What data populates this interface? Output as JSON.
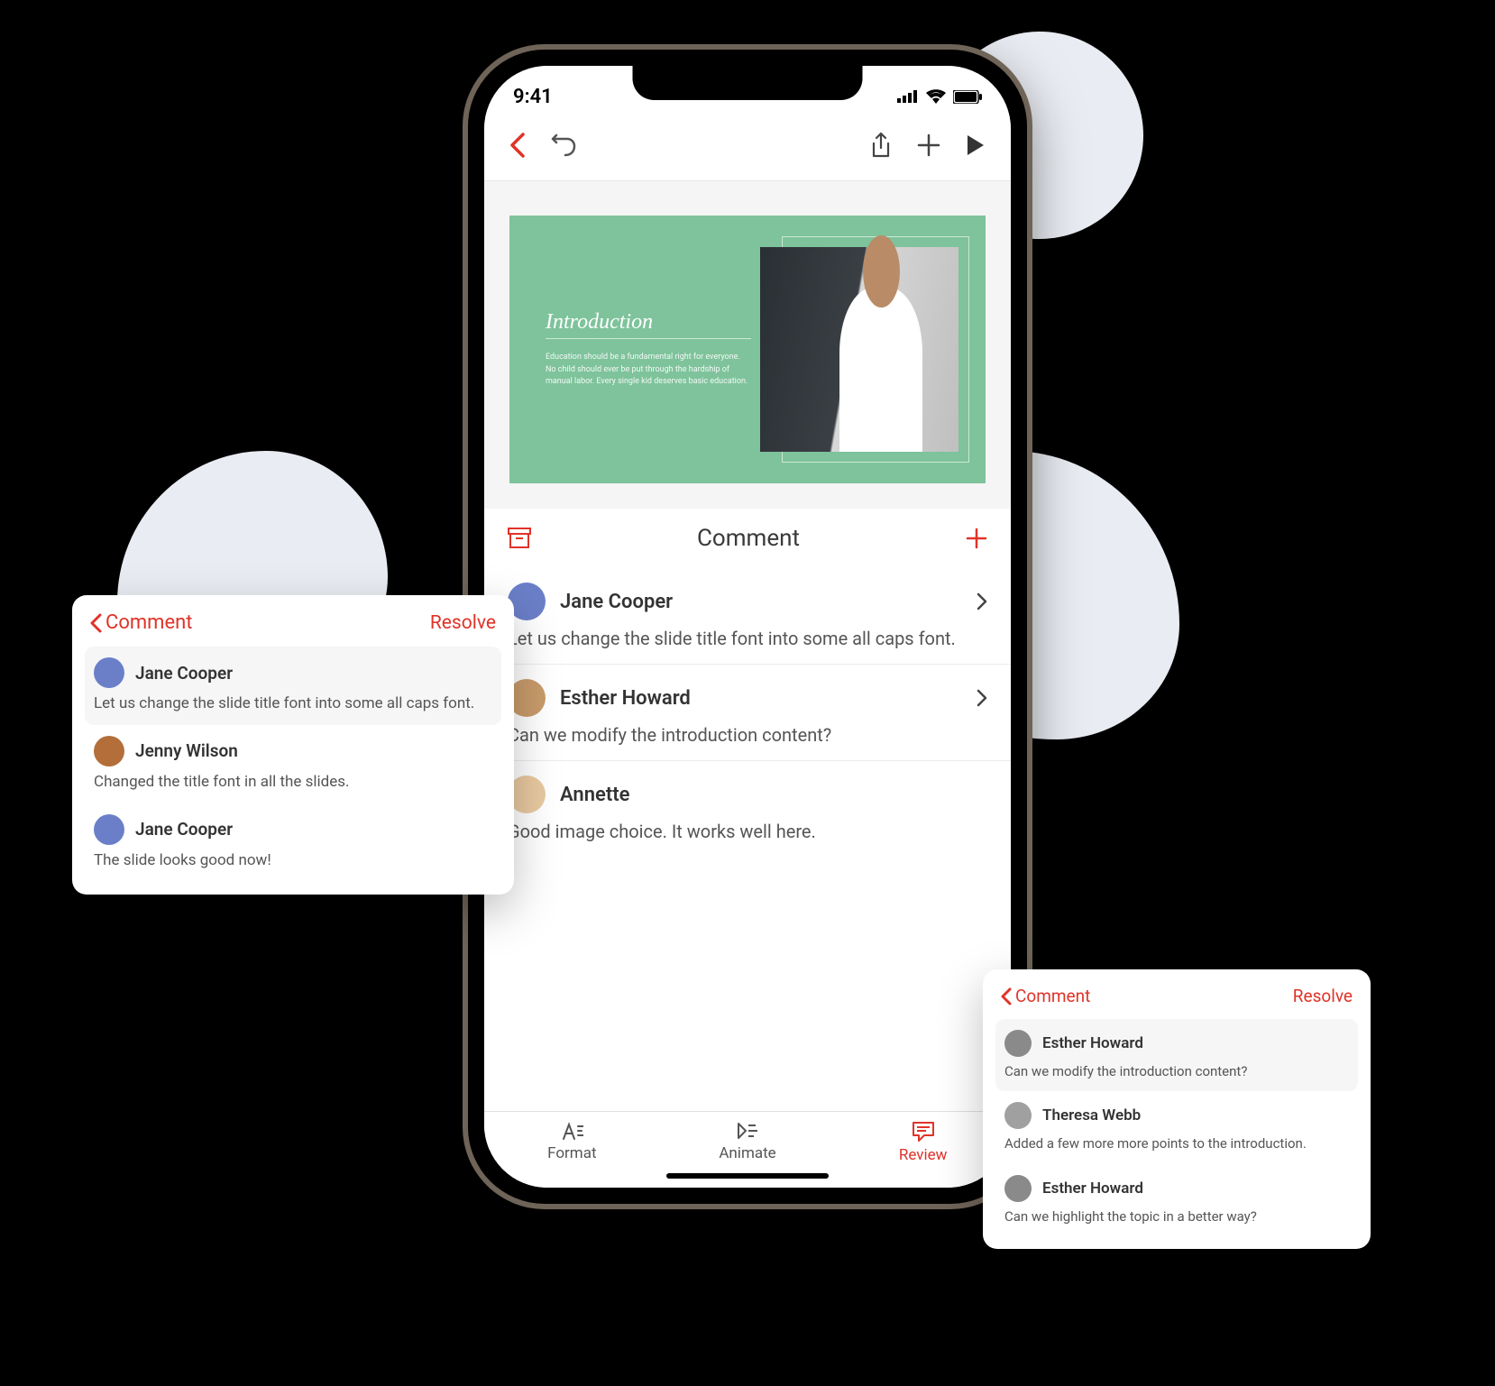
{
  "status": {
    "time": "9:41"
  },
  "slide": {
    "title": "Introduction",
    "body": "Education should be a fundamental right for everyone. No child should ever be put through the hardship of manual labor. Every single kid deserves basic education."
  },
  "panel": {
    "title": "Comment",
    "items": [
      {
        "name": "Jane Cooper",
        "body": "Let us change the slide title font into some all caps font."
      },
      {
        "name": "Esther Howard",
        "body": "Can we modify the introduction content?"
      },
      {
        "name": "Annette",
        "body": "Good image choice. It works well here."
      }
    ]
  },
  "tabs": {
    "format": "Format",
    "animate": "Animate",
    "review": "Review"
  },
  "left_card": {
    "back": "Comment",
    "resolve": "Resolve",
    "msgs": [
      {
        "name": "Jane Cooper",
        "body": "Let us change the slide title font into some all caps font."
      },
      {
        "name": "Jenny Wilson",
        "body": "Changed the title font in all the slides."
      },
      {
        "name": "Jane Cooper",
        "body": "The slide looks good now!"
      }
    ]
  },
  "right_card": {
    "back": "Comment",
    "resolve": "Resolve",
    "msgs": [
      {
        "name": "Esther Howard",
        "body": "Can we modify the introduction content?"
      },
      {
        "name": "Theresa Webb",
        "body": "Added a few more more points to the introduction."
      },
      {
        "name": "Esther Howard",
        "body": "Can we highlight the topic in a better way?"
      }
    ]
  }
}
